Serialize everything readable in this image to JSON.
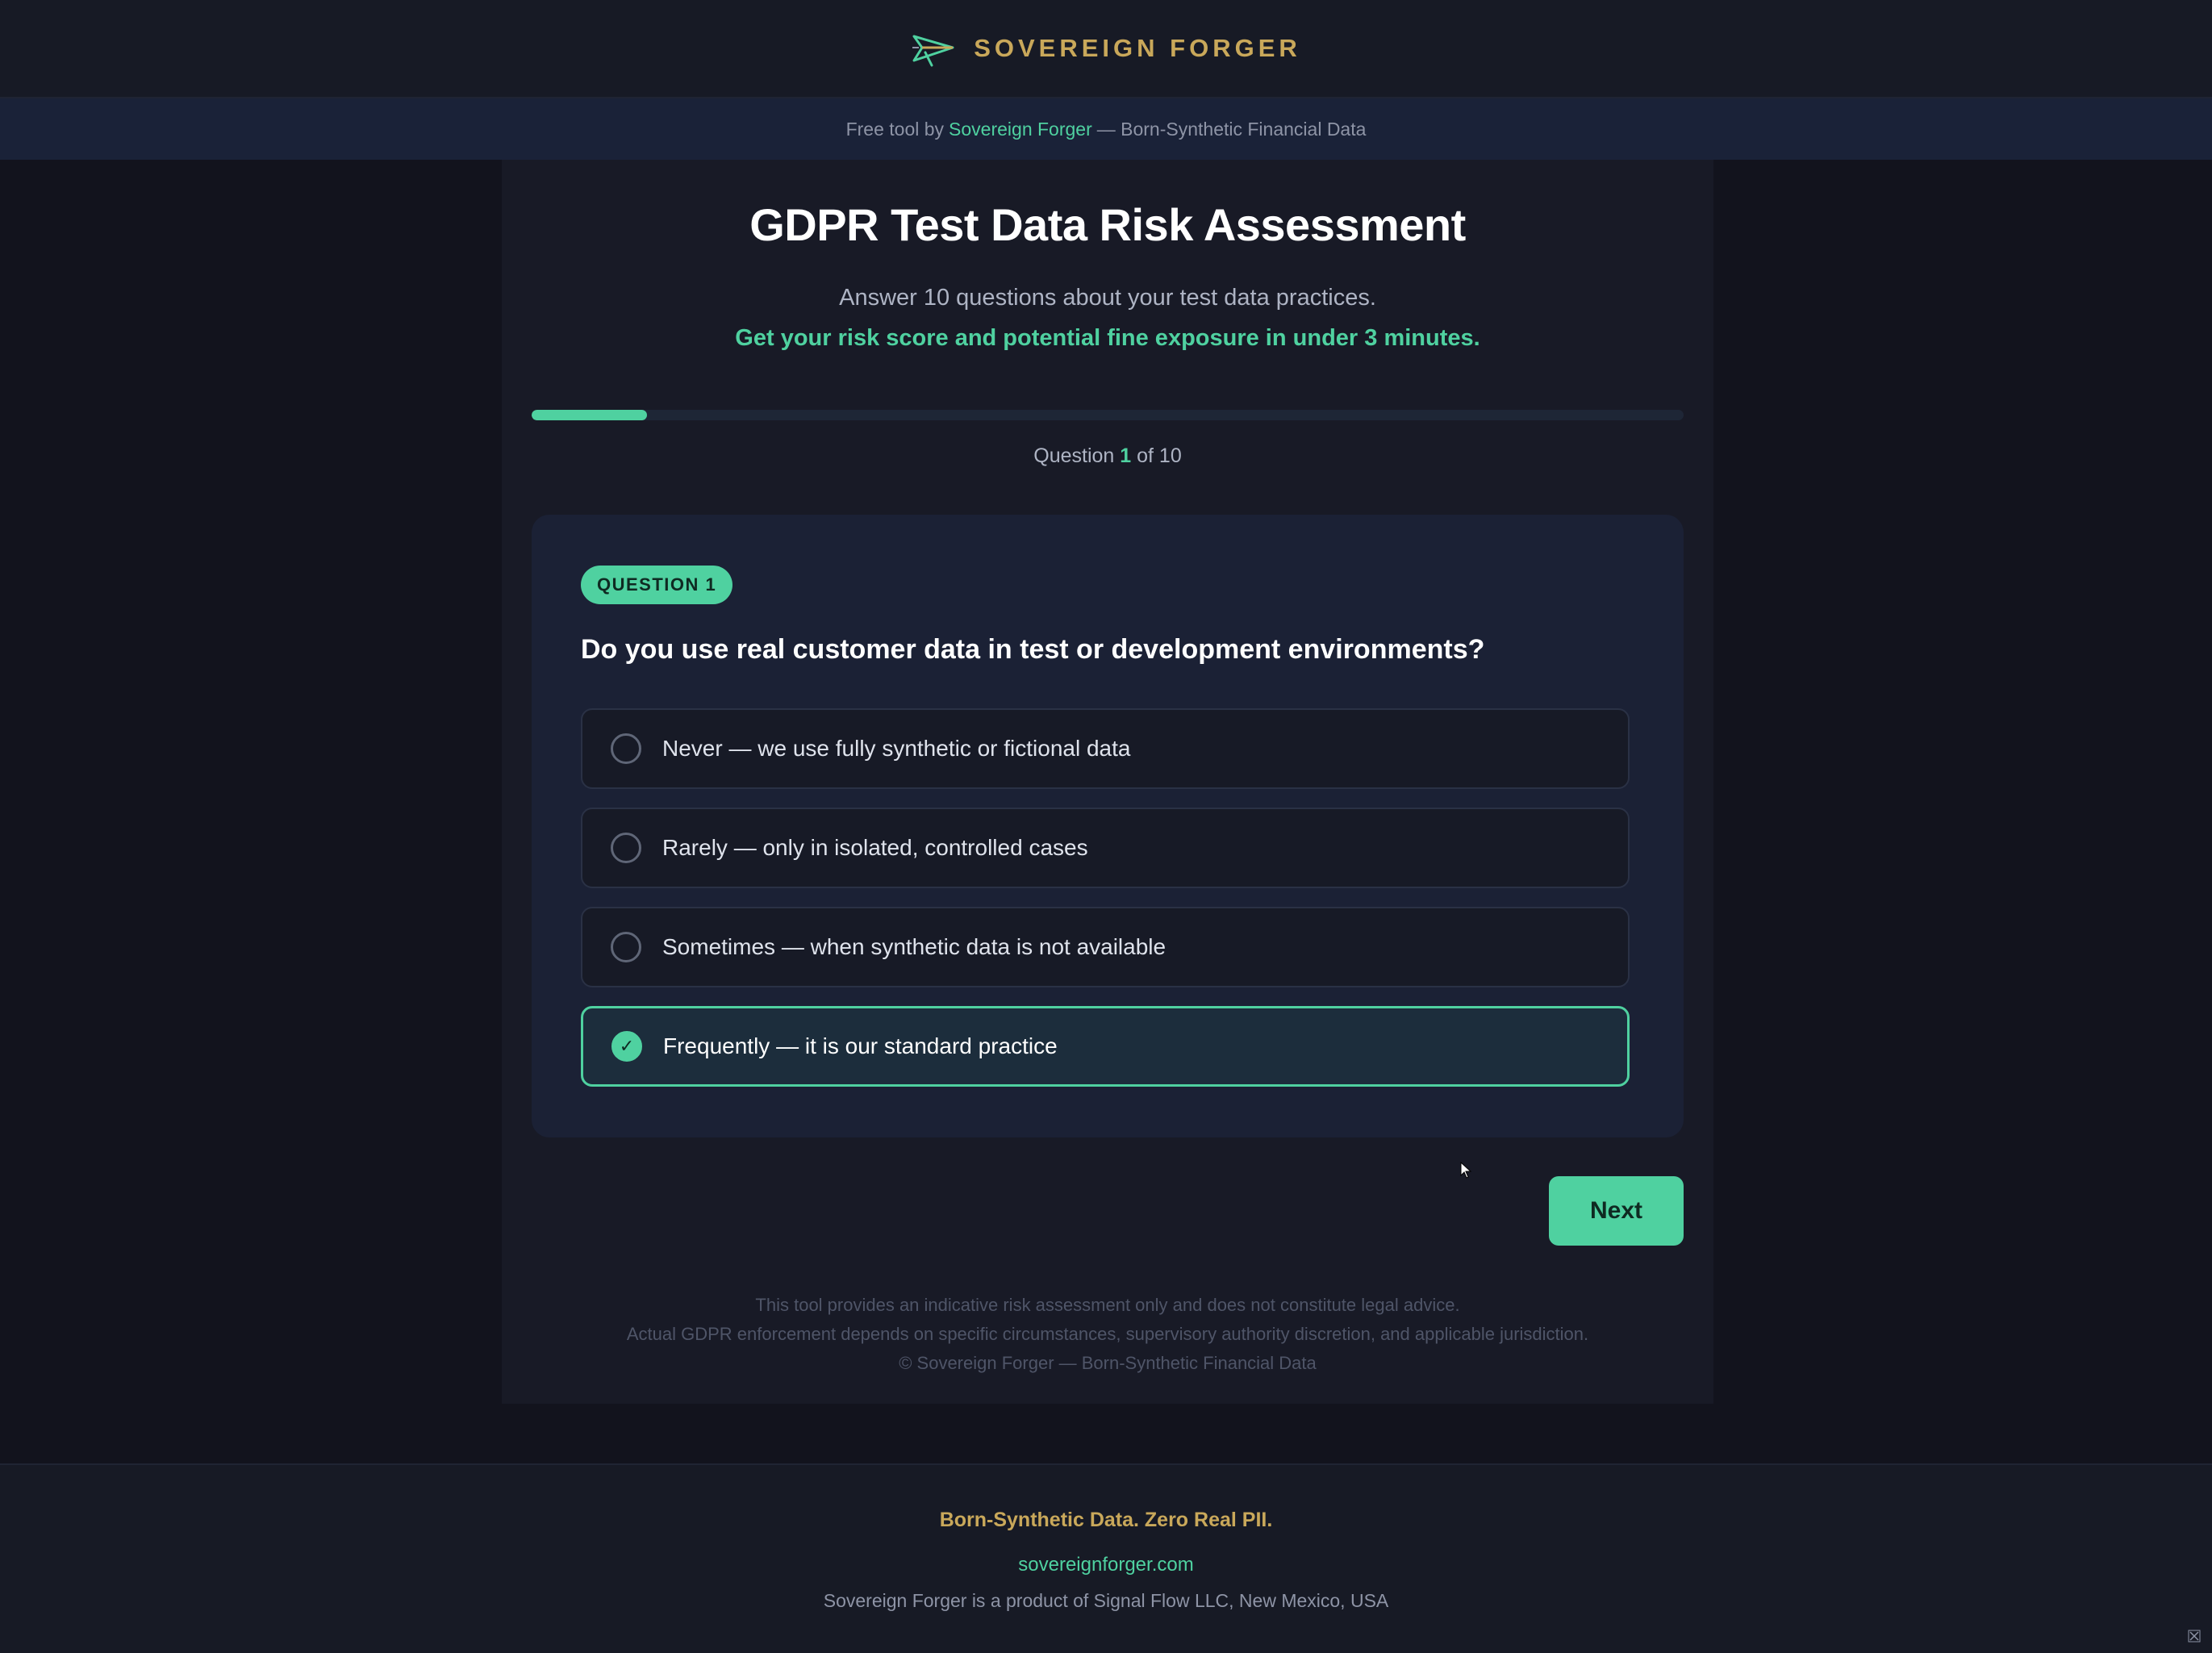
{
  "header": {
    "brand_name": "SOVEREIGN FORGER",
    "logo_icon": "paper-plane-icon"
  },
  "subbar": {
    "prefix": "Free tool by",
    "link": "Sovereign Forger",
    "suffix": "— Born-Synthetic Financial Data"
  },
  "main": {
    "title": "GDPR Test Data Risk Assessment",
    "intro": "Answer 10 questions about your test data practices.",
    "cta": "Get your risk score and potential fine exposure in under 3 minutes.",
    "progress": {
      "current": 1,
      "total": 10,
      "fraction": 0.1
    },
    "counter": {
      "label": "Question",
      "current": "1",
      "of": "of 10"
    }
  },
  "question_card": {
    "badge": "QUESTION 1",
    "question": "Do you use real customer data in test or development environments?",
    "options": [
      {
        "label": "Never — we use fully synthetic or fictional data",
        "selected": false
      },
      {
        "label": "Rarely — only in isolated, controlled cases",
        "selected": false
      },
      {
        "label": "Sometimes — when synthetic data is not available",
        "selected": false
      },
      {
        "label": "Frequently — it is our standard practice",
        "selected": true
      }
    ],
    "check_glyph": "✓"
  },
  "actions": {
    "next_label": "Next"
  },
  "disclaimer": {
    "line1": "This tool provides an indicative risk assessment only and does not constitute legal advice.",
    "line2": "Actual GDPR enforcement depends on specific circumstances, supervisory authority discretion, and applicable jurisdiction.",
    "line3": "© Sovereign Forger — Born-Synthetic Financial Data"
  },
  "footer": {
    "tagline": "Born-Synthetic Data. Zero Real PII.",
    "link": "sovereignforger.com",
    "company": "Sovereign Forger is a product of Signal Flow LLC, New Mexico, USA"
  },
  "colors": {
    "accent": "#4fd1a0",
    "brand_gold": "#c9a85a",
    "background": "#12131d",
    "card": "#1b2135"
  }
}
